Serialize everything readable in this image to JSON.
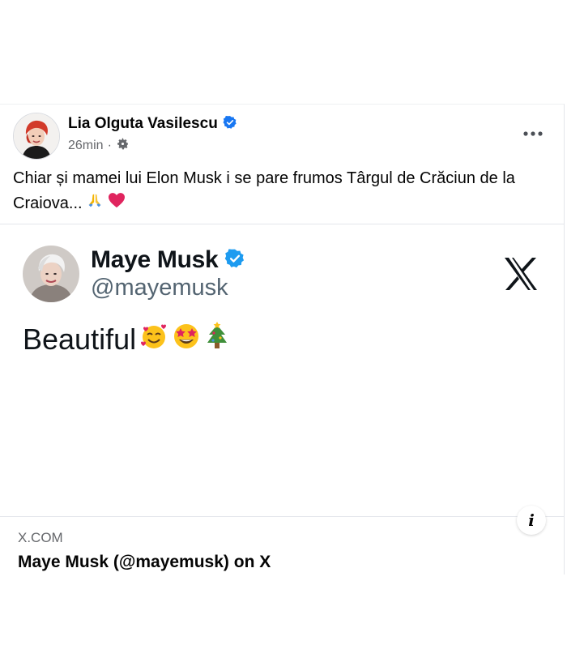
{
  "post": {
    "author": "Lia Olguta Vasilescu",
    "timestamp": "26min",
    "separator": "·",
    "audience_icon": "gear-icon",
    "more_icon": "more-horizontal-icon",
    "text": "Chiar și mamei lui Elon Musk i se pare frumos Târgul de Crăciun de la Craiova... ",
    "text_emojis": [
      "folded-hands-icon",
      "red-heart-icon"
    ]
  },
  "embed": {
    "name": "Maye Musk",
    "handle": "@mayemusk",
    "platform_icon": "x-logo-icon",
    "tweet_text": "Beautiful",
    "tweet_emojis": [
      "smiling-face-with-hearts-icon",
      "star-struck-icon",
      "christmas-tree-icon"
    ]
  },
  "link": {
    "domain": "X.COM",
    "title": "Maye Musk (@mayemusk) on X",
    "info_label": "i"
  },
  "colors": {
    "verified_blue": "#1d9bf0",
    "secondary_text": "#65676b",
    "heart_red": "#e0245e"
  }
}
